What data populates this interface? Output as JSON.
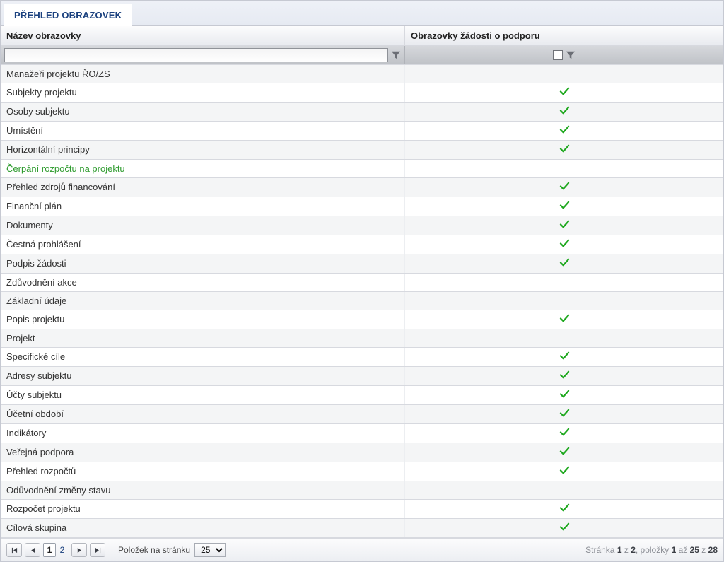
{
  "tab": {
    "title": "PŘEHLED OBRAZOVEK"
  },
  "columns": {
    "name": "Název obrazovky",
    "check": "Obrazovky žádosti o podporu"
  },
  "rows": [
    {
      "name": "Manažeři projektu ŘO/ZS",
      "checked": false,
      "highlight": false
    },
    {
      "name": "Subjekty projektu",
      "checked": true,
      "highlight": false
    },
    {
      "name": "Osoby subjektu",
      "checked": true,
      "highlight": false
    },
    {
      "name": "Umístění",
      "checked": true,
      "highlight": false
    },
    {
      "name": "Horizontální principy",
      "checked": true,
      "highlight": false
    },
    {
      "name": "Čerpání rozpočtu na projektu",
      "checked": false,
      "highlight": true
    },
    {
      "name": "Přehled zdrojů financování",
      "checked": true,
      "highlight": false
    },
    {
      "name": "Finanční plán",
      "checked": true,
      "highlight": false
    },
    {
      "name": "Dokumenty",
      "checked": true,
      "highlight": false
    },
    {
      "name": "Čestná prohlášení",
      "checked": true,
      "highlight": false
    },
    {
      "name": "Podpis žádosti",
      "checked": true,
      "highlight": false
    },
    {
      "name": "Zdůvodnění akce",
      "checked": false,
      "highlight": false
    },
    {
      "name": "Základní údaje",
      "checked": false,
      "highlight": false
    },
    {
      "name": "Popis projektu",
      "checked": true,
      "highlight": false
    },
    {
      "name": "Projekt",
      "checked": false,
      "highlight": false
    },
    {
      "name": "Specifické cíle",
      "checked": true,
      "highlight": false
    },
    {
      "name": "Adresy subjektu",
      "checked": true,
      "highlight": false
    },
    {
      "name": "Účty subjektu",
      "checked": true,
      "highlight": false
    },
    {
      "name": "Účetní období",
      "checked": true,
      "highlight": false
    },
    {
      "name": "Indikátory",
      "checked": true,
      "highlight": false
    },
    {
      "name": "Veřejná podpora",
      "checked": true,
      "highlight": false
    },
    {
      "name": "Přehled rozpočtů",
      "checked": true,
      "highlight": false
    },
    {
      "name": "Odůvodnění změny stavu",
      "checked": false,
      "highlight": false
    },
    {
      "name": "Rozpočet projektu",
      "checked": true,
      "highlight": false
    },
    {
      "name": "Cílová skupina",
      "checked": true,
      "highlight": false
    }
  ],
  "pager": {
    "pages": [
      "1",
      "2"
    ],
    "current": "1",
    "items_label": "Položek na stránku",
    "page_size": "25",
    "status_prefix": "Stránka ",
    "status_page_current": "1",
    "status_page_sep": " z ",
    "status_page_total": "2",
    "status_items_sep": ", položky ",
    "status_item_from": "1",
    "status_item_to_sep": " až ",
    "status_item_to": "25",
    "status_of_sep": " z ",
    "status_item_total": "28"
  }
}
